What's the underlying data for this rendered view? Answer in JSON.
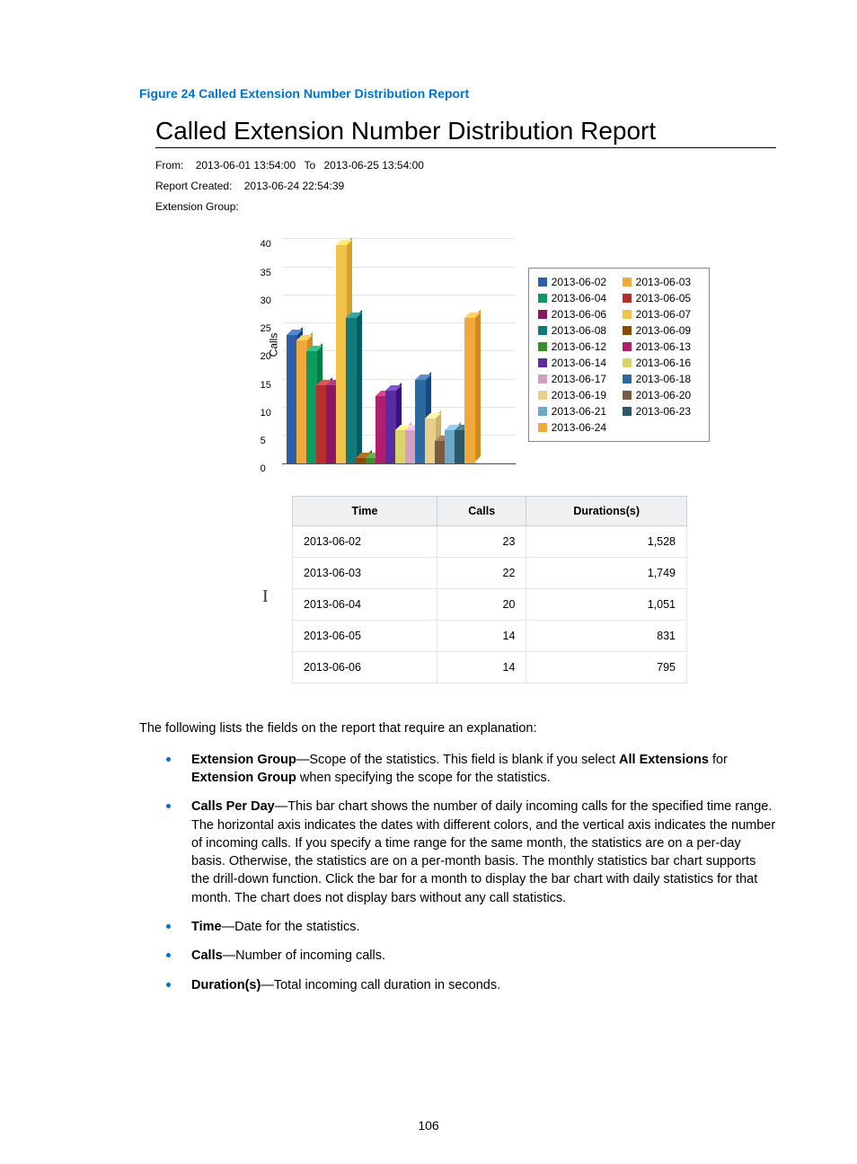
{
  "figure_caption": "Figure 24 Called Extension Number Distribution Report",
  "report": {
    "title": "Called Extension Number Distribution Report",
    "from_label": "From:",
    "from_value": "2013-06-01 13:54:00",
    "to_label": "To",
    "to_value": "2013-06-25 13:54:00",
    "created_label": "Report Created:",
    "created_value": "2013-06-24 22:54:39",
    "ext_group_label": "Extension Group:",
    "ext_group_value": ""
  },
  "chart_data": {
    "type": "bar",
    "ylabel": "Calls",
    "ylim": [
      0,
      40
    ],
    "yticks": [
      0,
      5,
      10,
      15,
      20,
      25,
      30,
      35,
      40
    ],
    "series": [
      {
        "name": "2013-06-02",
        "value": 23,
        "color": "#2f5ea8"
      },
      {
        "name": "2013-06-03",
        "value": 22,
        "color": "#f2a93c"
      },
      {
        "name": "2013-06-04",
        "value": 20,
        "color": "#0d9b62"
      },
      {
        "name": "2013-06-05",
        "value": 14,
        "color": "#b82e2e"
      },
      {
        "name": "2013-06-06",
        "value": 14,
        "color": "#8a1760"
      },
      {
        "name": "2013-06-07",
        "value": 39,
        "color": "#f0c24a"
      },
      {
        "name": "2013-06-08",
        "value": 26,
        "color": "#117a7a"
      },
      {
        "name": "2013-06-09",
        "value": 1,
        "color": "#8a4a00"
      },
      {
        "name": "2013-06-12",
        "value": 1,
        "color": "#3a8e2e"
      },
      {
        "name": "2013-06-13",
        "value": 12,
        "color": "#b11e6d"
      },
      {
        "name": "2013-06-14",
        "value": 13,
        "color": "#5a2ca0"
      },
      {
        "name": "2013-06-16",
        "value": 6,
        "color": "#d9d36a"
      },
      {
        "name": "2013-06-17",
        "value": 6,
        "color": "#d39fc2"
      },
      {
        "name": "2013-06-18",
        "value": 15,
        "color": "#2d6aa0"
      },
      {
        "name": "2013-06-19",
        "value": 8,
        "color": "#e8d08a"
      },
      {
        "name": "2013-06-20",
        "value": 4,
        "color": "#7c5a3d"
      },
      {
        "name": "2013-06-21",
        "value": 6,
        "color": "#6aa9c9"
      },
      {
        "name": "2013-06-23",
        "value": 6,
        "color": "#2a5a6a"
      },
      {
        "name": "2013-06-24",
        "value": 26,
        "color": "#f2a93c"
      }
    ]
  },
  "table": {
    "headers": [
      "Time",
      "Calls",
      "Durations(s)"
    ],
    "rows": [
      {
        "time": "2013-06-02",
        "calls": "23",
        "duration": "1,528"
      },
      {
        "time": "2013-06-03",
        "calls": "22",
        "duration": "1,749"
      },
      {
        "time": "2013-06-04",
        "calls": "20",
        "duration": "1,051"
      },
      {
        "time": "2013-06-05",
        "calls": "14",
        "duration": "831"
      },
      {
        "time": "2013-06-06",
        "calls": "14",
        "duration": "795"
      }
    ]
  },
  "description": {
    "intro": "The following lists the fields on the report that require an explanation:",
    "items": [
      {
        "term": "Extension Group",
        "text": "—Scope of the statistics. This field is blank if you select ",
        "bold2": "All Extensions",
        "text2": " for ",
        "bold3": "Extension Group",
        "text3": " when specifying the scope for the statistics."
      },
      {
        "term": "Calls Per Day",
        "text": "—This bar chart shows the number of daily incoming calls for the specified time range. The horizontal axis indicates the dates with different colors, and the vertical axis indicates the number of incoming calls. If you specify a time range for the same month, the statistics are on a per-day basis. Otherwise, the statistics are on a per-month basis. The monthly statistics bar chart supports the drill-down function. Click the bar for a month to display the bar chart with daily statistics for that month. The chart does not display bars without any call statistics."
      },
      {
        "term": "Time",
        "text": "—Date for the statistics."
      },
      {
        "term": "Calls",
        "text": "—Number of incoming calls."
      },
      {
        "term": "Duration(s)",
        "text": "—Total incoming call duration in seconds."
      }
    ]
  },
  "page_number": "106"
}
